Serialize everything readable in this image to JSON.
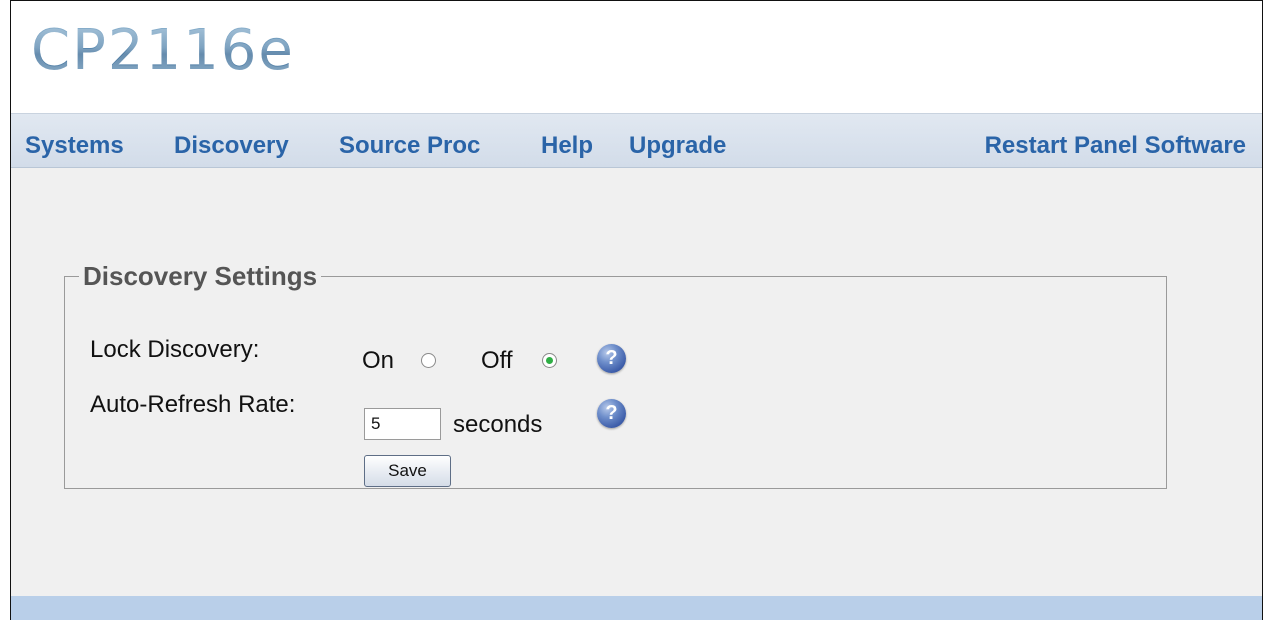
{
  "app": {
    "logo_text": "CP2116e"
  },
  "nav": {
    "items": [
      {
        "label": "Systems"
      },
      {
        "label": "Discovery"
      },
      {
        "label": "Source Proc"
      },
      {
        "label": "Help"
      },
      {
        "label": "Upgrade"
      }
    ],
    "restart_label": "Restart Panel Software"
  },
  "discovery_settings": {
    "legend": "Discovery Settings",
    "lock_discovery": {
      "label": "Lock Discovery:",
      "on_label": "On",
      "off_label": "Off",
      "selected": "Off"
    },
    "auto_refresh": {
      "label": "Auto-Refresh Rate:",
      "value": "5",
      "unit": "seconds"
    },
    "save_label": "Save"
  },
  "icons": {
    "help": "help-icon"
  },
  "colors": {
    "nav_link": "#2a64a8",
    "nav_bg": "#d8e1ec",
    "page_bg": "#f0f0f0",
    "footer_bg": "#b9cfe9",
    "radio_checked": "#2fae45"
  }
}
